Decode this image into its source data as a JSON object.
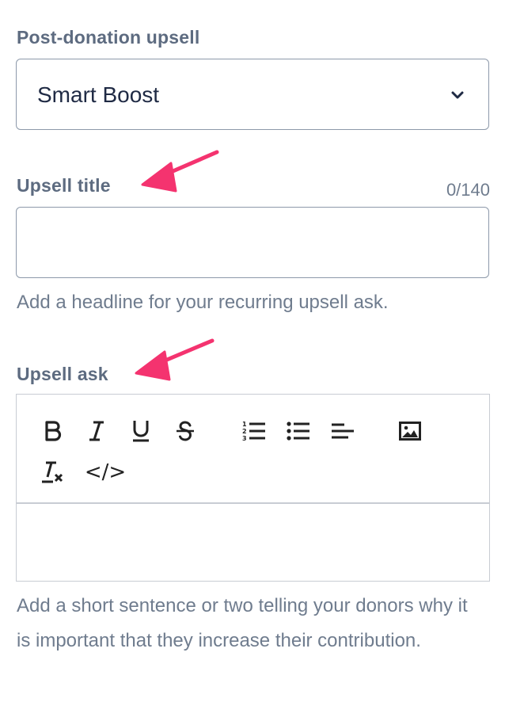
{
  "upsell_type": {
    "label": "Post-donation upsell",
    "selected": "Smart Boost",
    "chevron_icon": "chevron-down-icon"
  },
  "upsell_title": {
    "label": "Upsell title",
    "counter": "0/140",
    "value": "",
    "help": "Add a headline for your recurring upsell ask."
  },
  "upsell_ask": {
    "label": "Upsell ask",
    "toolbar": {
      "bold_icon": "bold-icon",
      "italic_icon": "italic-icon",
      "underline_icon": "underline-icon",
      "strikethrough_icon": "strikethrough-icon",
      "ordered_list_icon": "ordered-list-icon",
      "bullet_list_icon": "bullet-list-icon",
      "align_left_icon": "align-left-icon",
      "image_icon": "image-icon",
      "clear_format_icon": "clear-format-icon",
      "code_label": "</>"
    },
    "help": "Add a short sentence or two telling your donors why it is important that they increase their contribution."
  },
  "colors": {
    "annotation_arrow": "#f4336f",
    "label": "#5d6b80",
    "help_text": "#6f7c8e",
    "input_border": "#8d99aa"
  }
}
